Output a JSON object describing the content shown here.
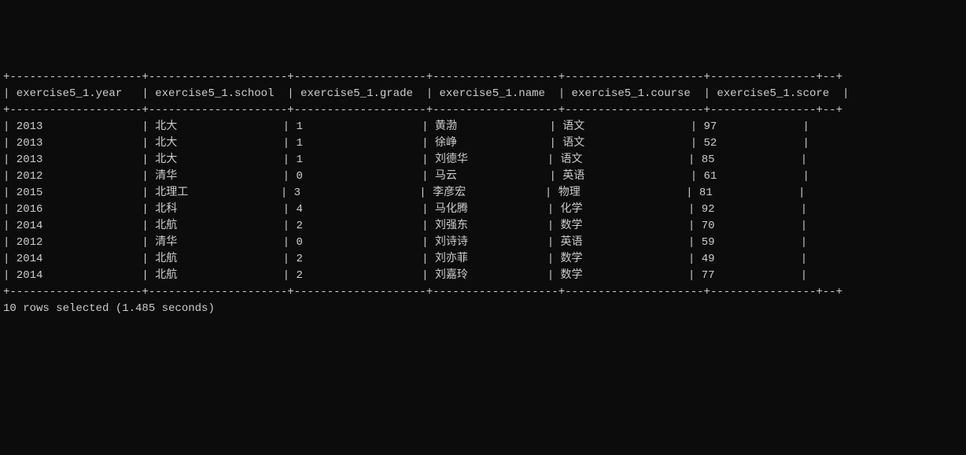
{
  "separator_line": "+--------------------+---------------------+--------------------+-------------------+---------------------+----------------+--+",
  "header_line": "| exercise5_1.year   | exercise5_1.school  | exercise5_1.grade  | exercise5_1.name  | exercise5_1.course  | exercise5_1.score  |",
  "chart_data": {
    "type": "table",
    "columns": [
      "exercise5_1.year",
      "exercise5_1.school",
      "exercise5_1.grade",
      "exercise5_1.name",
      "exercise5_1.course",
      "exercise5_1.score"
    ],
    "rows": [
      {
        "year": "2013",
        "school": "北大",
        "grade": "1",
        "name": "黄渤",
        "course": "语文",
        "score": "97"
      },
      {
        "year": "2013",
        "school": "北大",
        "grade": "1",
        "name": "徐峥",
        "course": "语文",
        "score": "52"
      },
      {
        "year": "2013",
        "school": "北大",
        "grade": "1",
        "name": "刘德华",
        "course": "语文",
        "score": "85"
      },
      {
        "year": "2012",
        "school": "清华",
        "grade": "0",
        "name": "马云",
        "course": "英语",
        "score": "61"
      },
      {
        "year": "2015",
        "school": "北理工",
        "grade": "3",
        "name": "李彦宏",
        "course": "物理",
        "score": "81"
      },
      {
        "year": "2016",
        "school": "北科",
        "grade": "4",
        "name": "马化腾",
        "course": "化学",
        "score": "92"
      },
      {
        "year": "2014",
        "school": "北航",
        "grade": "2",
        "name": "刘强东",
        "course": "数学",
        "score": "70"
      },
      {
        "year": "2012",
        "school": "清华",
        "grade": "0",
        "name": "刘诗诗",
        "course": "英语",
        "score": "59"
      },
      {
        "year": "2014",
        "school": "北航",
        "grade": "2",
        "name": "刘亦菲",
        "course": "数学",
        "score": "49"
      },
      {
        "year": "2014",
        "school": "北航",
        "grade": "2",
        "name": "刘嘉玲",
        "course": "数学",
        "score": "77"
      }
    ]
  },
  "footer": "10 rows selected (1.485 seconds)",
  "colwidths": {
    "year": 18,
    "school": 19,
    "grade": 18,
    "name": 17,
    "course": 19,
    "score": 14
  }
}
